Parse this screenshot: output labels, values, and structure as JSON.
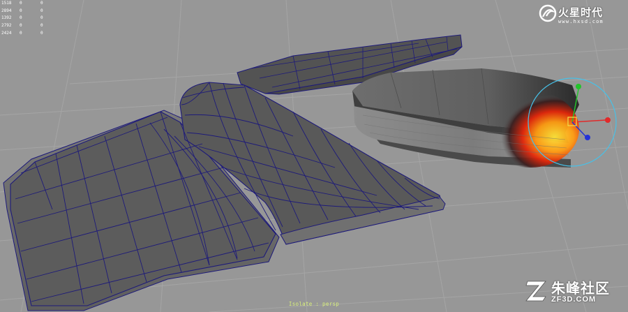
{
  "viewport": {
    "camera": "persp",
    "status_text": "Isolate : persp"
  },
  "hud": {
    "rows": [
      {
        "c1": "1518",
        "c2": "0",
        "c3": "0"
      },
      {
        "c1": "2894",
        "c2": "0",
        "c3": "0"
      },
      {
        "c1": "1392",
        "c2": "0",
        "c3": "0"
      },
      {
        "c1": "2792",
        "c2": "0",
        "c3": "0"
      },
      {
        "c1": "2424",
        "c2": "0",
        "c3": "0"
      }
    ]
  },
  "watermark_top": {
    "brand": "火星时代",
    "url": "www.hxsd.com"
  },
  "watermark_bottom": {
    "brand": "朱峰社区",
    "url": "ZF3D.COM"
  },
  "colors": {
    "background": "#979797",
    "grid": "#a8a8a8",
    "wire": "#1d1a7a",
    "mesh": "#5b5b5b",
    "status": "#d9f07c",
    "manip_x": "#e12a2a",
    "manip_y": "#23c42b",
    "manip_z": "#2433d6",
    "manip_ring": "#47c1e8"
  },
  "icons": [
    "manipulator-icon",
    "logo-swirl-icon",
    "logo-z-icon"
  ]
}
